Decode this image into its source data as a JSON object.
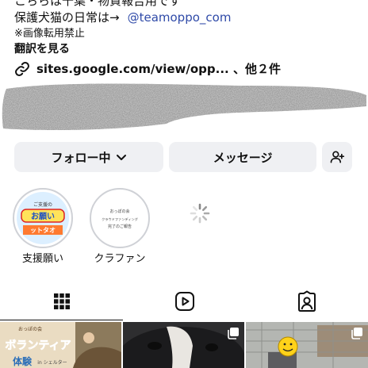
{
  "bio": {
    "line_cut": "こちらは千葉・物資報告用です",
    "line_dogs": "保護犬猫の日常は→",
    "mention": "@teamoppo_com",
    "notice": "※画像転用禁止",
    "translate": "翻訳を見る",
    "link_text": "sites.google.com/view/opp... 、他２件"
  },
  "actions": {
    "follow_label": "フォロー中",
    "message_label": "メッセージ"
  },
  "highlights": [
    {
      "label": "支援願い",
      "cover_small": "ご支援の",
      "cover_main": "お願い",
      "cover_sub": "ットタオ"
    },
    {
      "label": "クラファン",
      "cover_line1": "おっぽの会",
      "cover_line2": "クラウドファンディング",
      "cover_line3": "完了のご報告"
    }
  ],
  "posts": [
    {
      "caption_small": "おっぽの会",
      "caption_main": "ボランティア",
      "caption_main2": "体験",
      "caption_tail": "in シェルター"
    }
  ],
  "colors": {
    "button_bg": "#eff0f3",
    "mention": "#2f4aa8",
    "text": "#111111"
  },
  "icons": {
    "link": "link-icon",
    "chevron": "chevron-down-icon",
    "add_person": "add-person-icon",
    "grid": "grid-icon",
    "reels": "reels-icon",
    "tagged": "tagged-icon",
    "multi": "multi-photo-icon"
  }
}
